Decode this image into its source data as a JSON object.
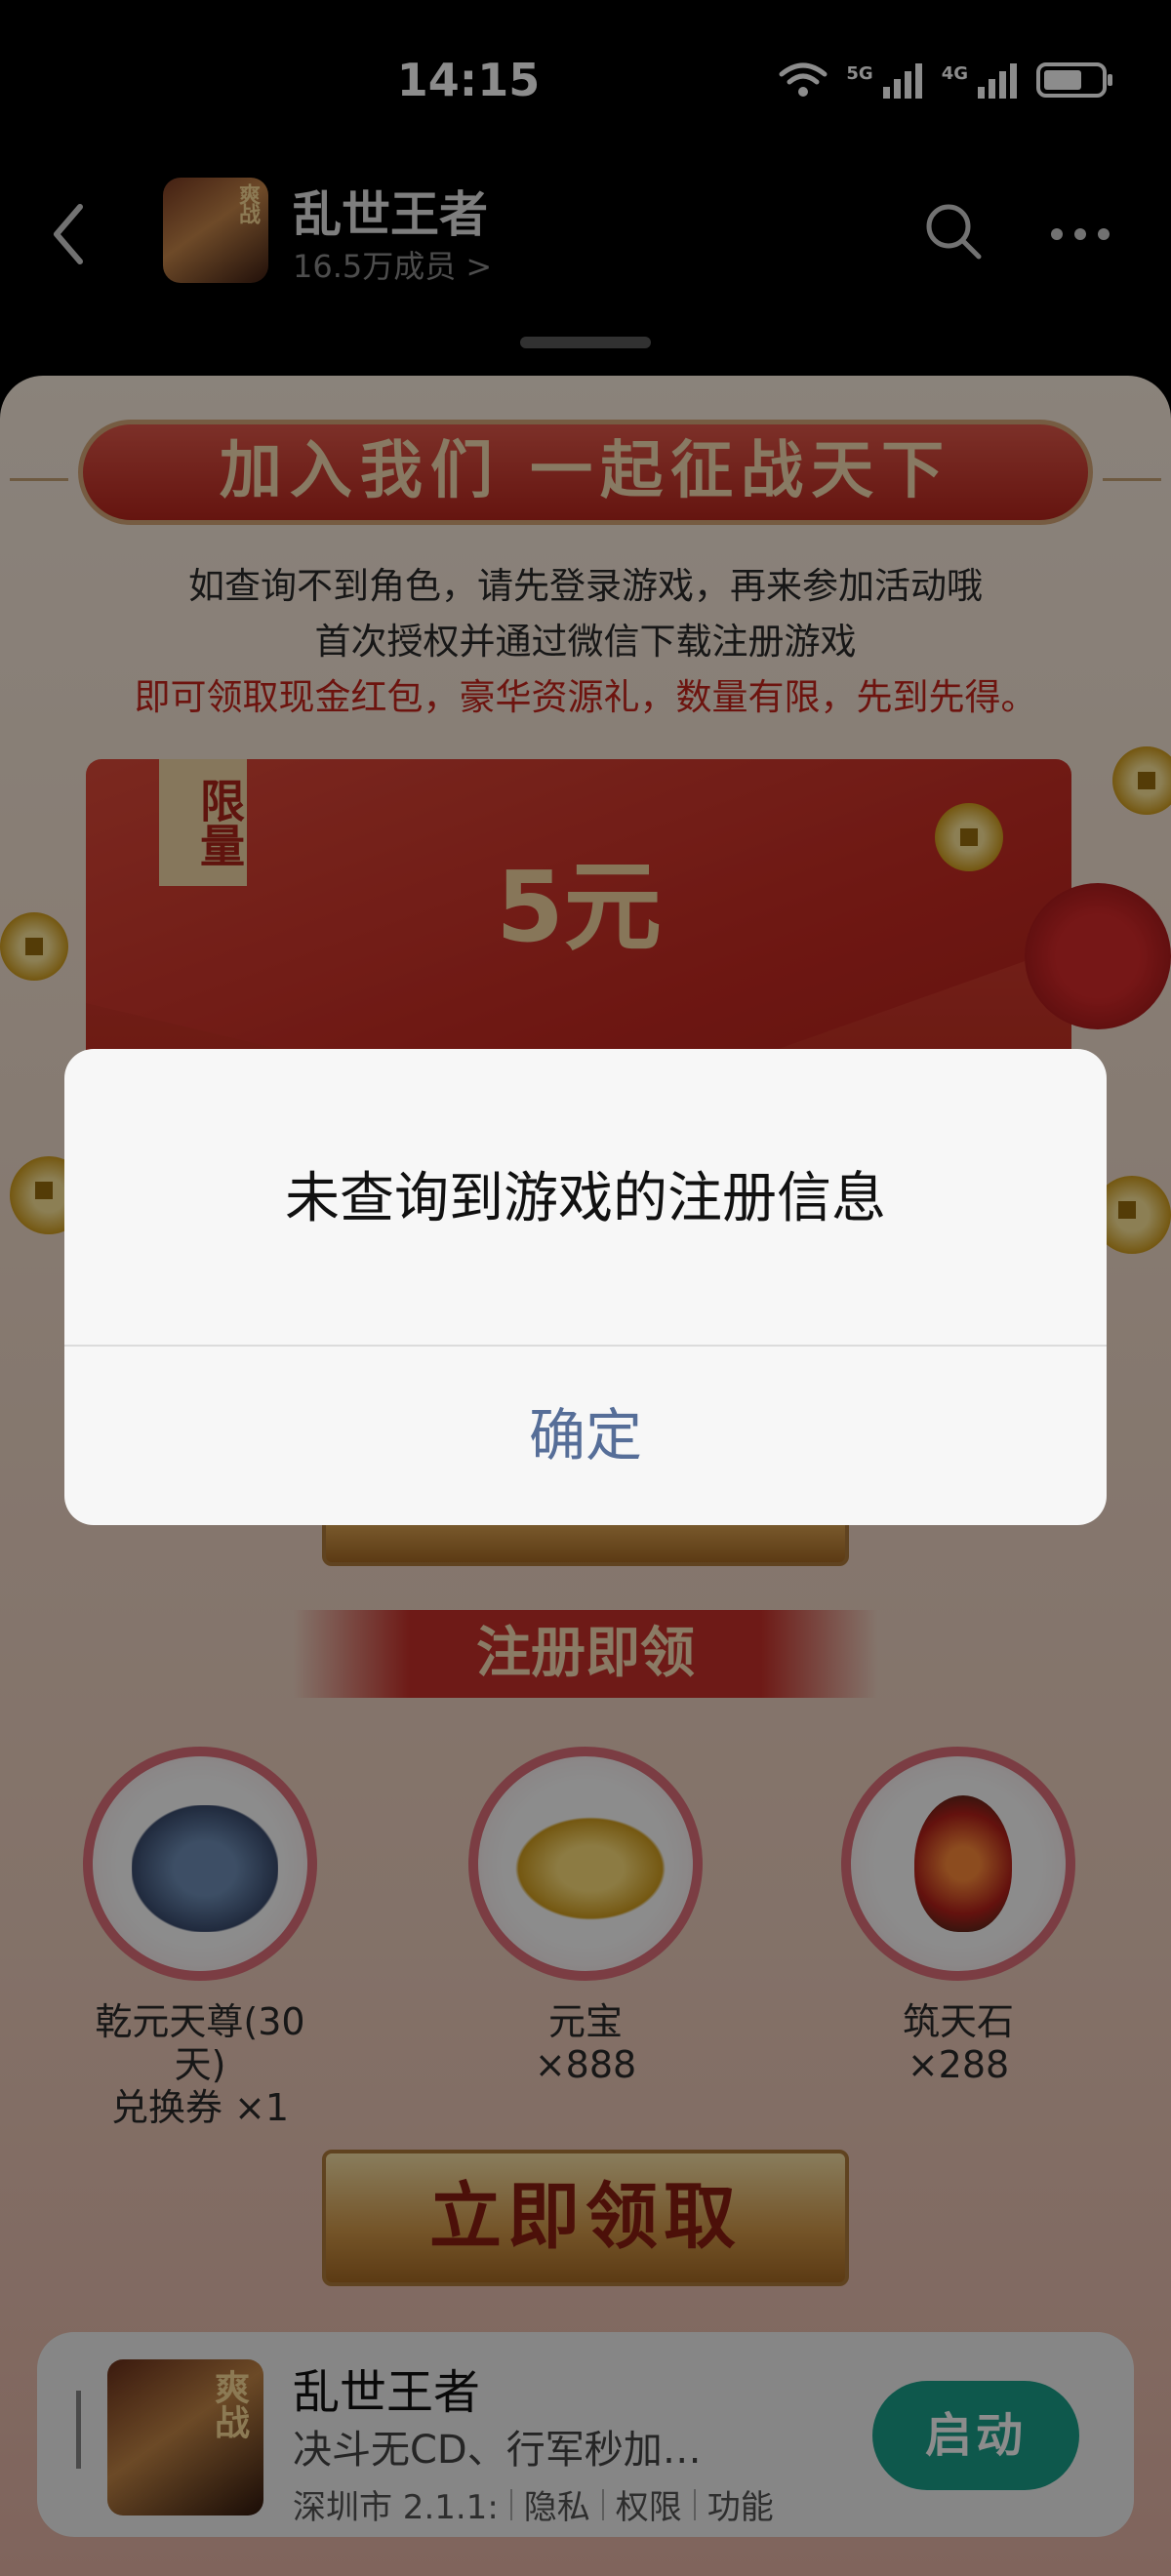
{
  "status_bar": {
    "time": "14:15",
    "signal_1": "5G",
    "signal_2": "4G"
  },
  "topbar": {
    "group_name": "乱世王者",
    "member_count": "16.5万成员 >",
    "avatar_tag": "爽战"
  },
  "page": {
    "banner_title": "加入我们 一起征战天下",
    "intro_line_1": "如查询不到角色，请先登录游戏，再来参加活动哦",
    "intro_line_2": "首次授权并通过微信下载注册游戏",
    "intro_line_3": "即可领取现金红包，豪华资源礼，数量有限，先到先得。",
    "limit_badge": "限量",
    "amount": "5元",
    "section_title": "注册即领",
    "rewards": [
      {
        "line1": "乾元天尊(30天)",
        "line2": "兑换券 ×1"
      },
      {
        "line1": "元宝",
        "line2": "×888"
      },
      {
        "line1": "筑天石",
        "line2": "×288"
      }
    ],
    "claim_button": "立即领取"
  },
  "app_card": {
    "name": "乱世王者",
    "avatar_tag": "爽战",
    "description": "决斗无CD、行军秒加…",
    "meta_location": "深圳市 2.1.1:",
    "meta_privacy": "隐私",
    "meta_permissions": "权限",
    "meta_features": "功能",
    "launch_button": "启动"
  },
  "dialog": {
    "title": "未查询到游戏的注册信息",
    "confirm": "确定"
  }
}
